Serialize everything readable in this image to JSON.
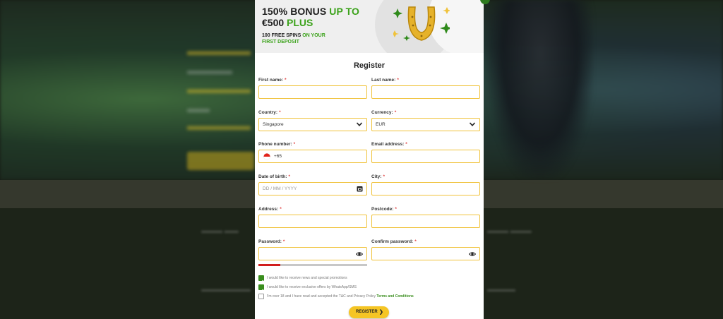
{
  "banner": {
    "bonus_line1_a": "150% BONUS",
    "bonus_line1_b": "UP TO",
    "bonus_line2_a": "€500",
    "bonus_line2_b": "PLUS",
    "spins_a": "100 FREE SPINS",
    "spins_b": "ON YOUR",
    "spins_c": "FIRST DEPOSIT",
    "icon": "horseshoe-icon"
  },
  "form": {
    "title": "Register",
    "required_mark": "*",
    "first_name": {
      "label": "First name:",
      "value": ""
    },
    "last_name": {
      "label": "Last name:",
      "value": ""
    },
    "country": {
      "label": "Country:",
      "value": "Singapore"
    },
    "currency": {
      "label": "Currency:",
      "value": "EUR"
    },
    "phone": {
      "label": "Phone number:",
      "prefix": "+65"
    },
    "email": {
      "label": "Email address:",
      "value": ""
    },
    "dob": {
      "label": "Date of birth:",
      "placeholder": "DD / MM / YYYY"
    },
    "city": {
      "label": "City:",
      "value": ""
    },
    "address": {
      "label": "Address:",
      "value": ""
    },
    "postcode": {
      "label": "Postcode:",
      "value": ""
    },
    "password": {
      "label": "Password:",
      "strength": 0.2
    },
    "confirm_password": {
      "label": "Confirm password:"
    },
    "checkboxes": [
      {
        "label": "I would like to receive news and special promotions",
        "checked": true
      },
      {
        "label": "I would like to receive exclusive offers by WhatsApp/SMS",
        "checked": true
      },
      {
        "label": "I'm over 18 and I have read and accepted the T&C and Privacy Policy",
        "link": "Terms and Conditions",
        "checked": false
      }
    ],
    "submit_label": "REGISTER",
    "submit_arrow": "❯"
  },
  "colors": {
    "accent_green": "#3ba21a",
    "field_border": "#f0c23a",
    "button_yellow": "#f5c524",
    "strength_red": "#d11e1e"
  }
}
